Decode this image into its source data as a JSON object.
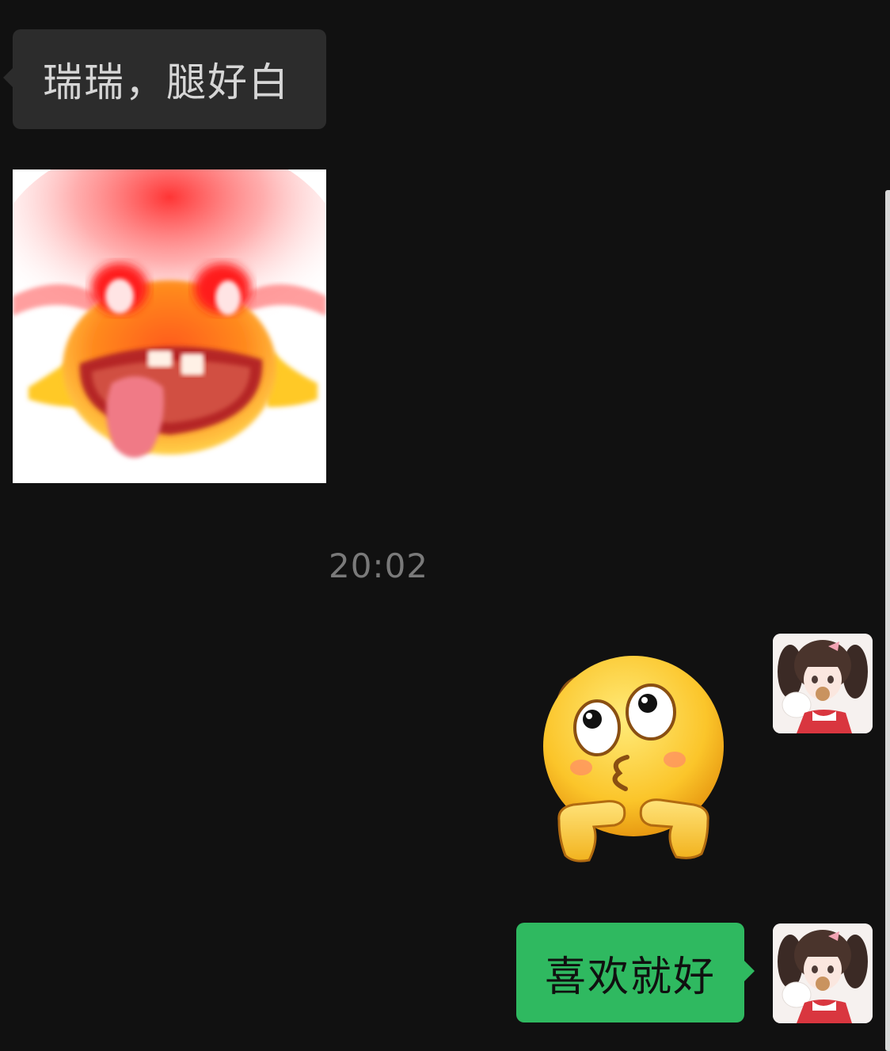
{
  "messages": {
    "incoming_text": "瑞瑞，腿好白",
    "timestamp": "20:02",
    "outgoing_text": "喜欢就好"
  },
  "icons": {
    "incoming_sticker": "excited-red-faced-creature-sticker",
    "outgoing_emoji": "pouting-face-with-hands-emoji",
    "avatar": "girl-with-teddy-bear-avatar"
  },
  "colors": {
    "background": "#111111",
    "incoming_bubble": "#2c2c2c",
    "outgoing_bubble": "#2fb960",
    "timestamp": "#7a7a7a"
  }
}
